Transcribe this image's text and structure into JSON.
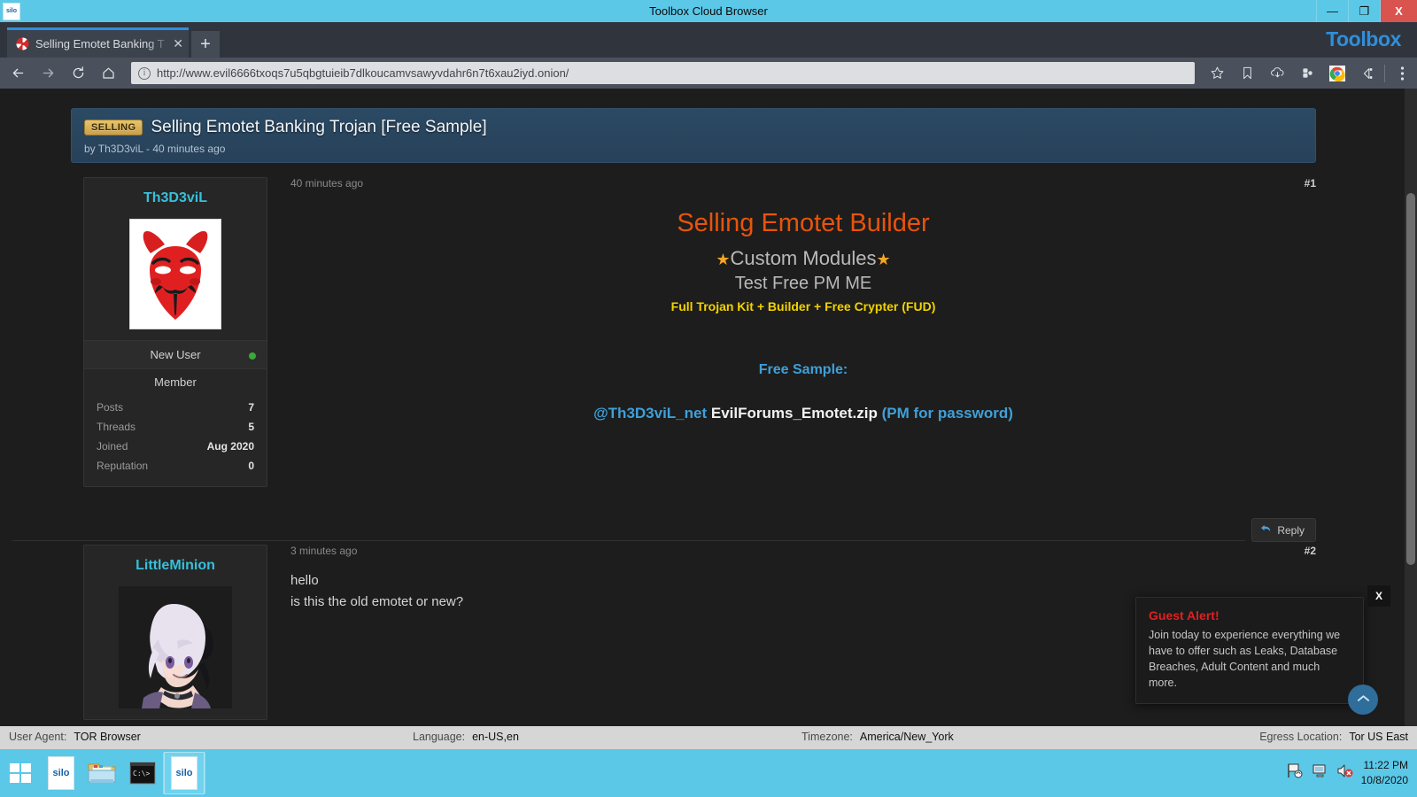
{
  "window": {
    "title": "Toolbox Cloud Browser",
    "silo_badge": "silo",
    "minimize": "—",
    "maximize": "❐",
    "close": "X"
  },
  "browser": {
    "brand": "Toolbox",
    "tab": {
      "title": "Selling Emotet Banking T",
      "favicon": "pinwheel-icon",
      "close": "✕"
    },
    "newtab_label": "+",
    "nav": {
      "back": "←",
      "forward": "→",
      "reload": "⟳",
      "home": "⌂"
    },
    "url": "http://www.evil6666txoqs7u5qbgtuieib7dlkoucamvsawyvdahr6n7t6xau2iyd.onion/",
    "url_info_glyph": "i",
    "toolbar_icons": [
      "star-icon",
      "bookmark-icon",
      "cloud-download-icon",
      "extension-icon",
      "chrome-icon",
      "share-icon",
      "menu-icon"
    ]
  },
  "thread": {
    "badge": "SELLING",
    "title": "Selling Emotet Banking Trojan [Free Sample]",
    "subtitle": "by Th3D3viL - 40 minutes ago"
  },
  "posts": [
    {
      "number": "#1",
      "time": "40 minutes ago",
      "user": {
        "name": "Th3D3viL",
        "avatar": "devil-mask-avatar",
        "status": "New User",
        "online": true,
        "group": "Member",
        "stats": [
          {
            "label": "Posts",
            "value": "7"
          },
          {
            "label": "Threads",
            "value": "5"
          },
          {
            "label": "Joined",
            "value": "Aug 2020"
          },
          {
            "label": "Reputation",
            "value": "0"
          }
        ]
      },
      "ad": {
        "headline": "Selling Emotet Builder",
        "subline": "Custom Modules",
        "star_left": "★",
        "star_right": "★",
        "tagline": "Test Free PM ME",
        "kit_line": "Full Trojan Kit + Builder + Free Crypter (FUD)",
        "free_label": "Free Sample:",
        "sample_handle": "@Th3D3viL_net",
        "sample_file": "EvilForums_Emotet.zip",
        "sample_note": "(PM for password)"
      },
      "reply_label": "Reply",
      "reply_icon": "reply-arrow-icon"
    },
    {
      "number": "#2",
      "time": "3 minutes ago",
      "user": {
        "name": "LittleMinion",
        "avatar": "anime-girl-avatar"
      },
      "lines": [
        "hello",
        "is this the old emotet or new?"
      ]
    }
  ],
  "guest_alert": {
    "title": "Guest Alert!",
    "body": "Join today to experience everything we have to offer such as Leaks, Database Breaches, Adult Content and much more.",
    "close": "X"
  },
  "scroll_top_icon": "chevron-up-icon",
  "statusbar": {
    "user_agent_label": "User Agent:",
    "user_agent_value": "TOR Browser",
    "language_label": "Language:",
    "language_value": "en-US,en",
    "timezone_label": "Timezone:",
    "timezone_value": "America/New_York",
    "egress_label": "Egress Location:",
    "egress_value": "Tor US East"
  },
  "taskbar": {
    "start": "windows-start-icon",
    "items": [
      "silo",
      "folder-icon",
      "terminal-icon",
      "silo"
    ],
    "tray_icons": [
      "network-flag-icon",
      "display-icon",
      "volume-muted-icon"
    ],
    "time": "11:22 PM",
    "date": "10/8/2020"
  },
  "colors": {
    "accent_blue": "#5bc8e8",
    "brand_blue": "#2f8fdc",
    "link_blue": "#3fa0d8",
    "user_cyan": "#37c0da",
    "headline_orange": "#e8540c",
    "kit_yellow": "#f2d200",
    "alert_red": "#e02020",
    "badge_gold": "#caa04a"
  }
}
